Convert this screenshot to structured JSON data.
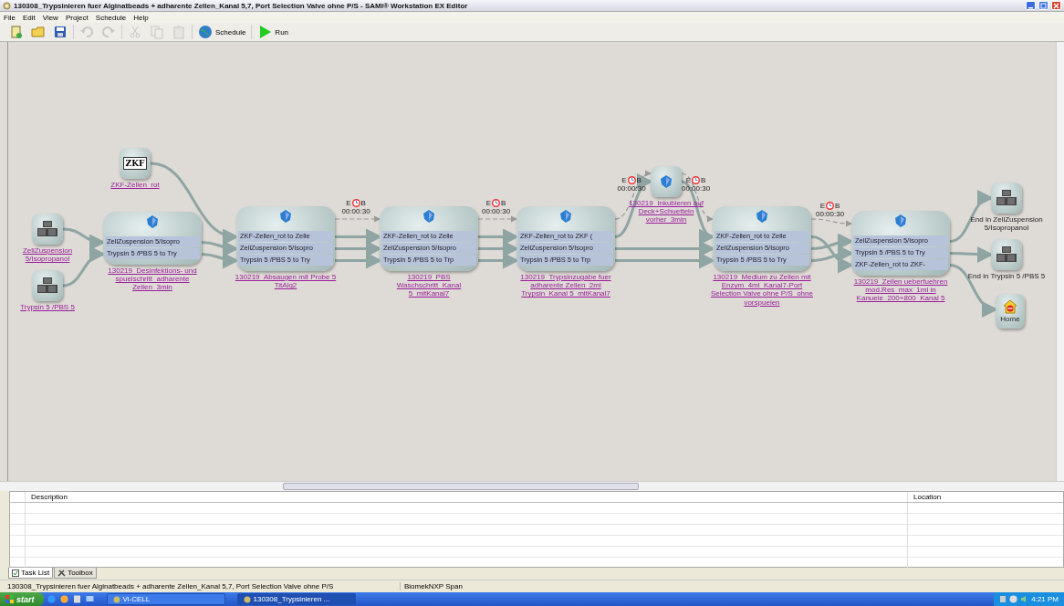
{
  "window": {
    "title": "130308_Trypsinieren fuer Alginatbeads + adharente Zellen_Kanal 5,7, Port Selection Valve ohne P/S - SAMI® Workstation EX Editor"
  },
  "menu": [
    "File",
    "Edit",
    "View",
    "Project",
    "Schedule",
    "Help"
  ],
  "toolbar": [
    {
      "kind": "new",
      "disabled": false
    },
    {
      "kind": "open",
      "disabled": false
    },
    {
      "kind": "save",
      "disabled": false
    },
    {
      "kind": "undo",
      "disabled": true
    },
    {
      "kind": "redo",
      "disabled": true
    },
    {
      "kind": "cut",
      "disabled": true
    },
    {
      "kind": "copy",
      "disabled": true
    },
    {
      "kind": "paste",
      "disabled": true
    },
    {
      "kind": "schedule",
      "disabled": false,
      "label": "Schedule"
    },
    {
      "kind": "run",
      "disabled": false,
      "label": "Run"
    }
  ],
  "canvas": {
    "nodes": [
      {
        "kind": "source",
        "label": "ZellZuspension 5/Isopropanol"
      },
      {
        "kind": "source",
        "label": "Trypsin 5 /PBS 5"
      },
      {
        "kind": "source_zkf",
        "icon_text": "ZKF",
        "label": "ZKF-Zellen_rot"
      },
      {
        "kind": "step",
        "rows": [
          "ZellZuspension 5/Isopro",
          "Trypsin 5 /PBS 5 to Try"
        ],
        "label": "130219_Desinfektions- und spuelschritt_adharente Zellen_3min"
      },
      {
        "kind": "step",
        "rows": [
          "ZKF-Zellen_rot to Zelle",
          "ZellZuspension 5/Isopro",
          "Trypsin 5 /PBS 5 to Try"
        ],
        "label": "130219_Absaugen mit Probe 5 TitAlg2"
      },
      {
        "kind": "step",
        "rows": [
          "ZKF-Zellen_rot to Zelle",
          "ZellZuspension 5/Isopro",
          "Trypsin 5 /PBS 5 to Trp"
        ],
        "label": "130219_PBS Waschschritt_Kanal 5_mitKanal7"
      },
      {
        "kind": "step",
        "rows": [
          "ZKF-Zellen_rot to ZKF (",
          "ZellZuspension 5/Isopro",
          "Trypsin 5 /PBS 5 to Trp"
        ],
        "label": "130219_Trypsinzugabe fuer adharente Zellen_2ml Trypsin_Kanal 5_mitKanal7"
      },
      {
        "kind": "delay",
        "label": "130219_Inkubieren auf Deck+Schuetteln vorher_3min"
      },
      {
        "kind": "step",
        "rows": [
          "ZKF-Zellen_rot to Zelle",
          "ZellZuspension 5/Isopro",
          "Trypsin 5 /PBS 5 to Try"
        ],
        "label": "130219_Medium zu Zellen mit Enzym_4ml_Kanal7-Port Selection Valve ohne P/S_ohne vorspuelen"
      },
      {
        "kind": "step",
        "rows": [
          "ZellZuspension 5/Isopro",
          "Trypsin 5 /PBS 5 to Try",
          "ZKF-Zellen_rot to ZKF-"
        ],
        "label": "130219_Zellen ueberfuehren mod.Res_max_1ml in Kanuele_200+800_Kanal 5"
      },
      {
        "kind": "end",
        "label": "End in ZellZuspension 5/Isopropanol"
      },
      {
        "kind": "end",
        "label": "End in Trypsin 5 /PBS 5"
      },
      {
        "kind": "home",
        "label": "Home"
      }
    ],
    "timers": [
      {
        "start": "E",
        "end": "B",
        "time": "00:00:30"
      },
      {
        "start": "E",
        "end": "B",
        "time": "00:00:30"
      },
      {
        "start": "E",
        "end": "B",
        "time": "00:00:30"
      },
      {
        "start": "E",
        "end": "B",
        "time": "00:00:30"
      },
      {
        "start": "E",
        "end": "B",
        "time": "00:00:30"
      }
    ]
  },
  "task_list": {
    "columns": [
      "Description",
      "Location"
    ]
  },
  "panel_tabs": [
    {
      "label": "Task List",
      "selected": true
    },
    {
      "label": "Toolbox",
      "selected": false
    }
  ],
  "status_bar": [
    "130308_Trypsinieren fuer Alginatbeads + adharente Zellen_Kanal 5,7, Port Selection Valve ohne P/S",
    "BiomekNXP Span"
  ],
  "taskbar": {
    "start": "start",
    "tasks": [
      {
        "label": "Vi-CELL",
        "selected": false
      },
      {
        "label": "130308_Trypsinieren ...",
        "selected": true
      }
    ],
    "clock": "4:21 PM"
  }
}
